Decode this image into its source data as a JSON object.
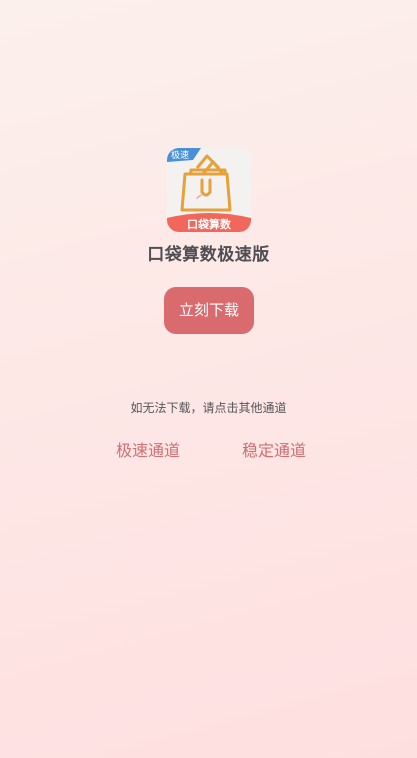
{
  "app": {
    "name": "口袋算数极速版",
    "icon": {
      "name": "shopping-bag-icon",
      "badge_text": "极速",
      "banner_text": "口袋算数",
      "colors": {
        "bag": "#e5a13a",
        "banner": "#f1675b",
        "badge": "#4a90d9",
        "background": "#f4f2f1"
      }
    }
  },
  "download": {
    "button_label": "立刻下载",
    "color": "#d96b6f"
  },
  "fallback": {
    "hint_text": "如无法下载，请点击其他通道",
    "channels": [
      {
        "label": "极速通道"
      },
      {
        "label": "稳定通道"
      }
    ],
    "link_color": "#d06e72"
  }
}
